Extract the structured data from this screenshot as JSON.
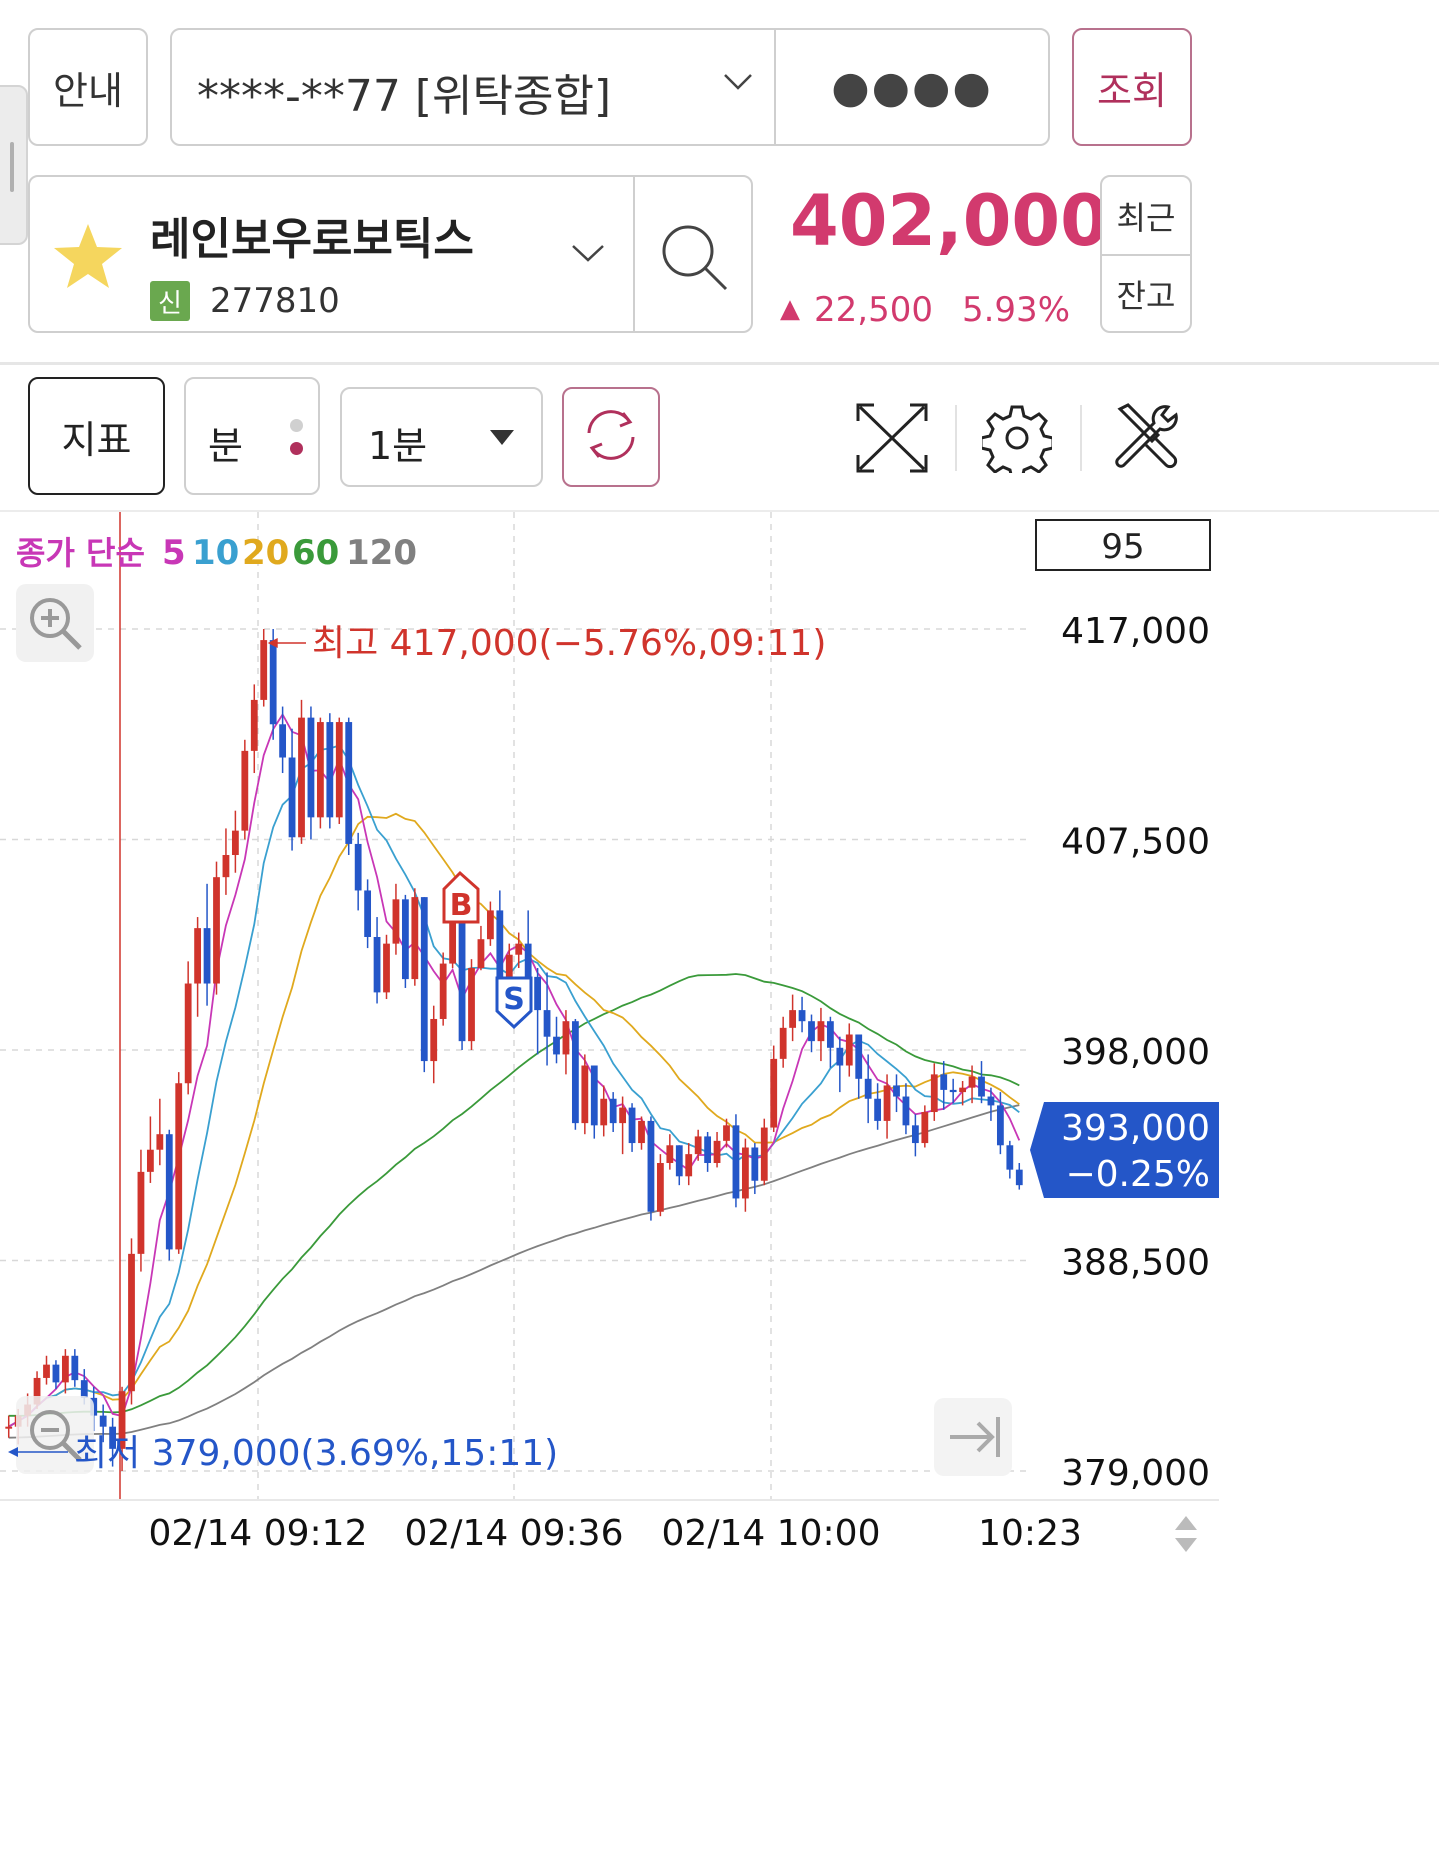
{
  "header": {
    "guide_label": "안내",
    "account": "****-**77 [위탁종합]",
    "password_mask": "●●●●",
    "query_label": "조회"
  },
  "stock": {
    "name": "레인보우로보틱스",
    "badge": "신",
    "code": "277810",
    "price": "402,000",
    "change_arrow": "▲",
    "change": "22,500",
    "change_pct": "5.93%",
    "recent_label": "최근",
    "balance_label": "잔고"
  },
  "toolbar": {
    "indicator_label": "지표",
    "period_label": "분",
    "interval_value": "1분"
  },
  "colors": {
    "up": "#d0342c",
    "down": "#2456c8",
    "ma5": "#c837b6",
    "ma10": "#3aa0d0",
    "ma20": "#e0a91e",
    "ma60": "#3a9a3a",
    "ma120": "#808080",
    "price_pink": "#d23a6e"
  },
  "chart_data": {
    "type": "candlestick",
    "legend": {
      "prefix": "종가 단순",
      "ma": [
        "5",
        "10",
        "20",
        "60",
        "120"
      ]
    },
    "count_box": "95",
    "y_ticks": [
      "417,000",
      "407,500",
      "398,000",
      "388,500",
      "379,000"
    ],
    "x_ticks": [
      "02/14 09:12",
      "02/14 09:36",
      "02/14 10:00",
      "10:23"
    ],
    "ylim": [
      379000,
      417000
    ],
    "high_annotation": "최고 417,000(−5.76%,09:11)",
    "low_annotation": "최저 379,000(3.69%,15:11)",
    "current_price": "393,000",
    "current_change": "−0.25%",
    "buy_marker": "B",
    "sell_marker": "S",
    "candles": [
      [
        381000,
        381500,
        380500,
        381000
      ],
      [
        381000,
        381800,
        380200,
        381500
      ],
      [
        381500,
        382500,
        381000,
        382000
      ],
      [
        382000,
        383500,
        381800,
        383200
      ],
      [
        383200,
        384200,
        382900,
        383800
      ],
      [
        383800,
        384000,
        382700,
        383000
      ],
      [
        383000,
        384500,
        382500,
        384200
      ],
      [
        384200,
        384500,
        382800,
        383100
      ],
      [
        383100,
        383600,
        382000,
        382300
      ],
      [
        382300,
        382800,
        380800,
        381500
      ],
      [
        381500,
        382000,
        380300,
        381000
      ],
      [
        381000,
        381400,
        379200,
        380000
      ],
      [
        380000,
        382800,
        379000,
        382600
      ],
      [
        382600,
        389500,
        382000,
        388800
      ],
      [
        388800,
        393500,
        388000,
        392500
      ],
      [
        392500,
        395000,
        392000,
        393500
      ],
      [
        393500,
        395800,
        392800,
        394200
      ],
      [
        394200,
        394400,
        388500,
        389000
      ],
      [
        389000,
        397000,
        388800,
        396500
      ],
      [
        396500,
        402000,
        396000,
        401000
      ],
      [
        401000,
        404000,
        399500,
        403500
      ],
      [
        403500,
        405500,
        400000,
        401000
      ],
      [
        401000,
        406500,
        400500,
        405800
      ],
      [
        405800,
        408000,
        405000,
        406800
      ],
      [
        406800,
        408800,
        406000,
        407900
      ],
      [
        407900,
        412000,
        407500,
        411500
      ],
      [
        411500,
        414500,
        410500,
        413800
      ],
      [
        413800,
        417000,
        413500,
        416500
      ],
      [
        416500,
        417000,
        412000,
        412700
      ],
      [
        412700,
        413500,
        410500,
        411200
      ],
      [
        411200,
        412500,
        407000,
        407600
      ],
      [
        407600,
        413800,
        407300,
        413000
      ],
      [
        413000,
        413500,
        407500,
        408500
      ],
      [
        408500,
        413000,
        408000,
        412800
      ],
      [
        412800,
        413200,
        408000,
        408500
      ],
      [
        408500,
        413000,
        408200,
        412800
      ],
      [
        412800,
        413000,
        406800,
        407300
      ],
      [
        407300,
        407800,
        404300,
        405200
      ],
      [
        405200,
        405700,
        402600,
        403100
      ],
      [
        403100,
        404000,
        400100,
        400600
      ],
      [
        400600,
        403200,
        400300,
        402800
      ],
      [
        402800,
        405500,
        402300,
        404800
      ],
      [
        404800,
        405000,
        400800,
        401200
      ],
      [
        401200,
        405300,
        400900,
        404900
      ],
      [
        404900,
        404900,
        397000,
        397500
      ],
      [
        397500,
        400000,
        396500,
        399400
      ],
      [
        399400,
        402400,
        399100,
        401900
      ],
      [
        401900,
        404700,
        401700,
        404400
      ],
      [
        404400,
        404400,
        398000,
        398400
      ],
      [
        398400,
        402100,
        398000,
        401700
      ],
      [
        401700,
        403600,
        401600,
        403000
      ],
      [
        403000,
        404700,
        402700,
        404300
      ],
      [
        404300,
        405200,
        400500,
        401200
      ],
      [
        401200,
        402800,
        400700,
        402300
      ],
      [
        402300,
        403300,
        401700,
        402800
      ],
      [
        402800,
        404300,
        400800,
        401300
      ],
      [
        401300,
        401700,
        397800,
        399800
      ],
      [
        399800,
        401500,
        397300,
        398600
      ],
      [
        398600,
        399500,
        397400,
        397800
      ],
      [
        397800,
        399800,
        396900,
        399300
      ],
      [
        399300,
        399400,
        394400,
        394700
      ],
      [
        394700,
        397800,
        394200,
        397300
      ],
      [
        397300,
        397300,
        394000,
        394600
      ],
      [
        394600,
        396400,
        394100,
        395800
      ],
      [
        395800,
        396100,
        394300,
        394700
      ],
      [
        394700,
        395900,
        393300,
        395400
      ],
      [
        395400,
        395600,
        393400,
        393800
      ],
      [
        393800,
        395000,
        393500,
        394800
      ],
      [
        394800,
        395000,
        390300,
        390700
      ],
      [
        390700,
        393300,
        390500,
        392900
      ],
      [
        392900,
        394200,
        392600,
        393700
      ],
      [
        393700,
        393700,
        391900,
        392300
      ],
      [
        392300,
        393800,
        391900,
        393300
      ],
      [
        393300,
        394400,
        393000,
        394100
      ],
      [
        394100,
        394300,
        392500,
        392900
      ],
      [
        392900,
        394300,
        392700,
        393900
      ],
      [
        393900,
        394900,
        393600,
        394600
      ],
      [
        394600,
        395100,
        390900,
        391300
      ],
      [
        391300,
        394000,
        390700,
        393600
      ],
      [
        393600,
        393800,
        391500,
        392100
      ],
      [
        392100,
        394900,
        391900,
        394500
      ],
      [
        394500,
        398200,
        394300,
        397600
      ],
      [
        397600,
        399500,
        397200,
        399000
      ],
      [
        399000,
        400500,
        398400,
        399800
      ],
      [
        399800,
        400400,
        398800,
        399300
      ],
      [
        399300,
        399600,
        397900,
        398400
      ],
      [
        398400,
        399900,
        397500,
        399300
      ],
      [
        399300,
        399500,
        397200,
        398100
      ],
      [
        398100,
        398600,
        396100,
        397300
      ],
      [
        397300,
        399200,
        396800,
        398700
      ],
      [
        398700,
        398700,
        395800,
        396700
      ],
      [
        396700,
        397800,
        394700,
        395800
      ],
      [
        395800,
        396500,
        394400,
        394800
      ],
      [
        394800,
        396900,
        394000,
        396400
      ],
      [
        396400,
        396900,
        395200,
        395900
      ],
      [
        395900,
        396500,
        394200,
        394600
      ],
      [
        394600,
        395100,
        393200,
        393800
      ],
      [
        393800,
        395500,
        393600,
        395200
      ],
      [
        395200,
        397400,
        394800,
        396900
      ],
      [
        396900,
        397500,
        395300,
        396200
      ],
      [
        396200,
        396700,
        395600,
        396100
      ],
      [
        396100,
        396600,
        395500,
        396300
      ],
      [
        396300,
        397300,
        395600,
        396800
      ],
      [
        396800,
        397500,
        395600,
        395900
      ],
      [
        395900,
        396300,
        394800,
        395500
      ],
      [
        395500,
        396100,
        393300,
        393700
      ],
      [
        393700,
        393900,
        392200,
        392600
      ],
      [
        392600,
        392900,
        391700,
        391900
      ]
    ]
  }
}
